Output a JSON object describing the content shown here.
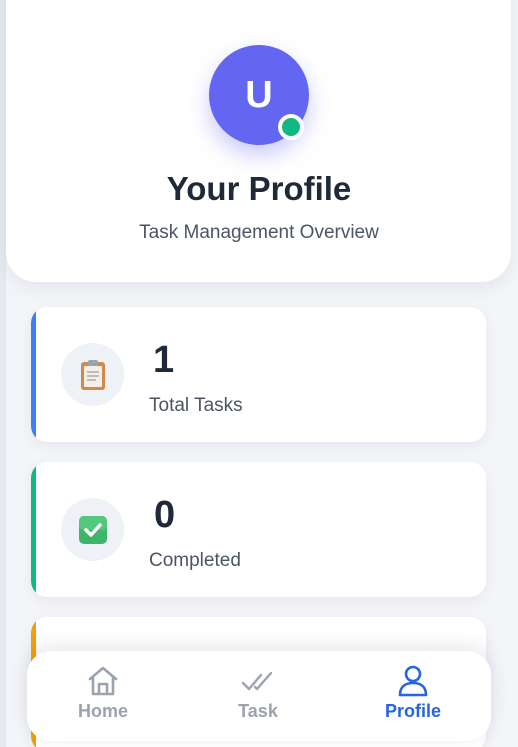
{
  "profile": {
    "avatar_initial": "U",
    "title": "Your Profile",
    "subtitle": "Task Management Overview"
  },
  "stats": [
    {
      "value": "1",
      "label": "Total Tasks",
      "icon": "clipboard-icon",
      "accent": "#3b82f6"
    },
    {
      "value": "0",
      "label": "Completed",
      "icon": "check-box-icon",
      "accent": "#10b981"
    },
    {
      "value": "",
      "label": "",
      "icon": "",
      "accent": "#f59e0b"
    }
  ],
  "nav": {
    "items": [
      {
        "label": "Home",
        "icon": "home-icon",
        "active": false
      },
      {
        "label": "Task",
        "icon": "double-check-icon",
        "active": false
      },
      {
        "label": "Profile",
        "icon": "user-icon",
        "active": true
      }
    ]
  },
  "colors": {
    "avatar": "#6366f1",
    "online": "#10b981",
    "nav_active": "#2563eb",
    "nav_inactive": "#9ca3af"
  }
}
